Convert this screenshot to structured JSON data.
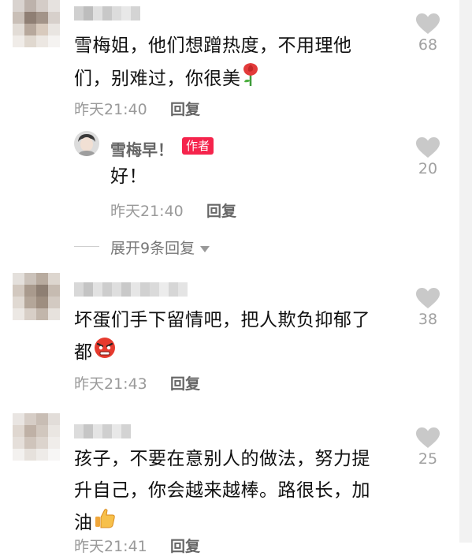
{
  "comments": [
    {
      "text_line1": "雪梅姐，他们想蹭热度，不用理他",
      "text_line2": "们，别难过，你很美",
      "emoji": "rose-emoji",
      "time": "昨天21:40",
      "reply_label": "回复",
      "likes": "68",
      "reply": {
        "author": "雪梅早！",
        "badge": "作者",
        "text": "好！",
        "time": "昨天21:40",
        "reply_label": "回复",
        "likes": "20"
      },
      "expand_label": "展开9条回复"
    },
    {
      "text_line1": "坏蛋们手下留情吧，把人欺负抑郁了",
      "text_line2": "都",
      "emoji": "angry-emoji",
      "time": "昨天21:43",
      "reply_label": "回复",
      "likes": "38"
    },
    {
      "text_line1": "孩子，不要在意别人的做法，努力提",
      "text_line2": "升自己，你会越来越棒。路很长，加",
      "text_line3": "油",
      "emoji": "thumbs-up-emoji",
      "time": "昨天21:41",
      "reply_label": "回复",
      "likes": "25"
    }
  ],
  "colors": {
    "badge": "#f5244c",
    "like_icon": "#c9c9c9",
    "text": "#111111",
    "meta": "#9a9a9a"
  }
}
